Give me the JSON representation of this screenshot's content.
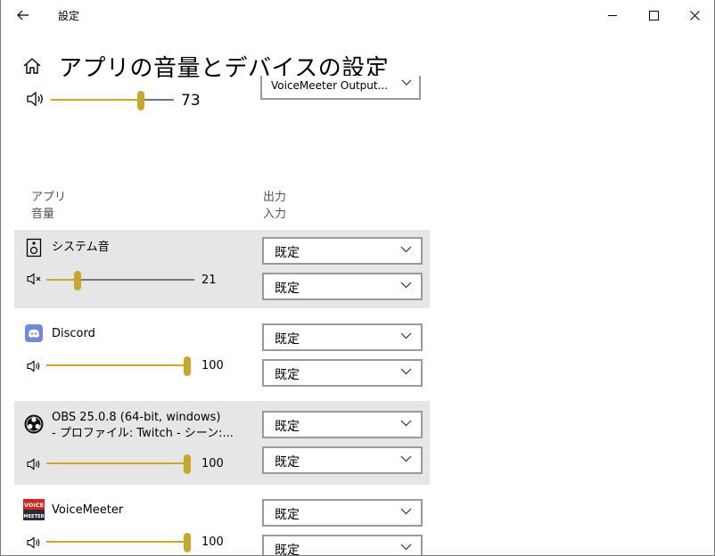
{
  "window": {
    "title": "設定",
    "back_icon": "arrow-left-icon",
    "minimize_icon": "minimize-icon",
    "maximize_icon": "maximize-icon",
    "close_icon": "close-icon"
  },
  "header": {
    "home_icon": "home-icon",
    "title": "アプリの音量とデバイスの設定"
  },
  "master": {
    "volume": 73,
    "volume_label": "73",
    "device": "VoiceMeeter Output..."
  },
  "columns": {
    "app_line1": "アプリ",
    "app_line2": "音量",
    "io_line1": "出力",
    "io_line2": "入力"
  },
  "apps": [
    {
      "name": "システム音",
      "icon": "speaker-icon",
      "volume": 21,
      "volume_label": "21",
      "muted": true,
      "output": "既定",
      "input": "既定"
    },
    {
      "name": "Discord",
      "icon": "discord-icon",
      "volume": 100,
      "volume_label": "100",
      "muted": false,
      "output": "既定",
      "input": "既定"
    },
    {
      "name": "OBS 25.0.8 (64-bit, windows)",
      "name_line2": "- プロファイル: Twitch - シーン:...",
      "icon": "obs-icon",
      "volume": 100,
      "volume_label": "100",
      "muted": false,
      "output": "既定",
      "input": "既定"
    },
    {
      "name": "VoiceMeeter",
      "icon": "voicemeeter-icon",
      "icon_text_top": "VOICE",
      "icon_text_bottom": "MEETER",
      "volume": 100,
      "volume_label": "100",
      "muted": false,
      "output": "既定",
      "input": "既定"
    }
  ],
  "colors": {
    "accent": "#c8a82b",
    "row_shade": "#e6e6e6",
    "track": "#777777",
    "discord": "#7289da",
    "voicemeeter_red": "#d9261c"
  }
}
